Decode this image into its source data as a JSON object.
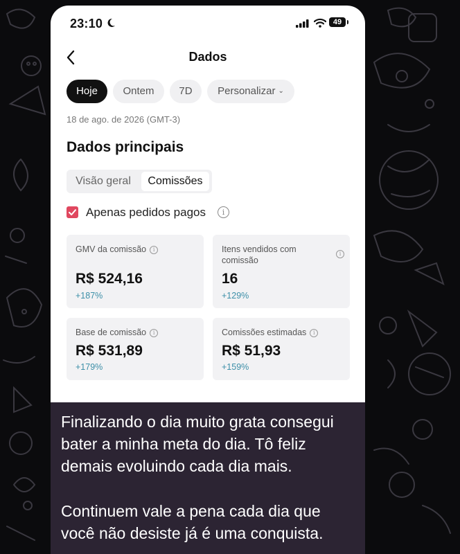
{
  "status_bar": {
    "time": "23:10",
    "battery": "49"
  },
  "header": {
    "title": "Dados"
  },
  "filters": {
    "chips": [
      {
        "label": "Hoje",
        "active": true
      },
      {
        "label": "Ontem",
        "active": false
      },
      {
        "label": "7D",
        "active": false
      },
      {
        "label": "Personalizar",
        "active": false
      }
    ],
    "date_range": "18 de ago. de 2026 (GMT-3)"
  },
  "main": {
    "section_title": "Dados principais",
    "tabs": [
      {
        "label": "Visão geral",
        "active": false
      },
      {
        "label": "Comissões",
        "active": true
      }
    ],
    "paid_only_label": "Apenas pedidos pagos",
    "metrics": [
      {
        "label": "GMV da comissão",
        "value": "R$ 524,16",
        "change": "+187%"
      },
      {
        "label": "Itens vendidos com comissão",
        "value": "16",
        "change": "+129%"
      },
      {
        "label": "Base de comissão",
        "value": "R$ 531,89",
        "change": "+179%"
      },
      {
        "label": "Comissões estimadas",
        "value": "R$ 51,93",
        "change": "+159%"
      }
    ]
  },
  "caption": {
    "paragraph_1_lines": [
      "Finalizando o dia muito grata consegui",
      "bater a minha meta do dia. Tô feliz",
      "demais evoluindo cada dia mais."
    ],
    "paragraph_2_lines": [
      "Continuem vale a pena cada dia que",
      "você não desiste já é uma conquista."
    ]
  },
  "colors": {
    "accent_check": "#e0475f",
    "change_positive": "#3c8fa8",
    "chip_active": "#111111",
    "caption_bg": "#2c2433"
  }
}
